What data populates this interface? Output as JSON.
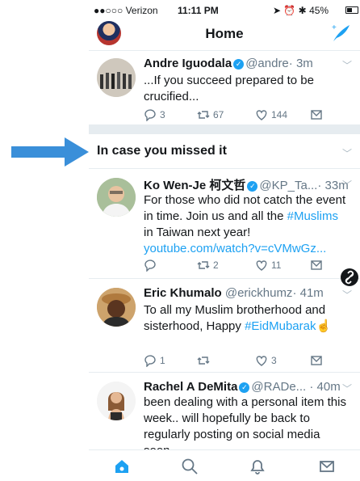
{
  "status": {
    "carrier": "●●○○○ Verizon",
    "time": "11:11 PM",
    "battery": "45%"
  },
  "header": {
    "title": "Home"
  },
  "tweets": [
    {
      "name": "Andre Iguodala",
      "handle": "@andre",
      "time": "· 3m",
      "text": "...If you succeed prepared to be crucified...",
      "replies": "3",
      "retweets": "67",
      "likes": "144"
    },
    {
      "name": "Ko Wen-Je 柯文哲",
      "handle": "@KP_Ta...",
      "time": "· 33m",
      "text_pre": "For those who did not catch the event in time. Join us and all the ",
      "hashtag": "#Muslims",
      "text_mid": " in Taiwan next year! ",
      "link": "youtube.com/watch?v=cVMwGz...",
      "replies": "",
      "retweets": "2",
      "likes": "11"
    },
    {
      "name": "Eric Khumalo",
      "handle": "@erickhumz",
      "time": "· 41m",
      "text_pre": "To all my Muslim brotherhood and sisterhood, Happy ",
      "hashtag": "#EidMubarak",
      "emoji": "☝",
      "replies": "1",
      "retweets": "",
      "likes": "3"
    },
    {
      "name": "Rachel A DeMita",
      "handle": "@RADe...",
      "time": "· 40m",
      "text": "been dealing with a personal item this week.. will hopefully be back to regularly posting on social media soon."
    }
  ],
  "section": {
    "title": "In case you missed it"
  },
  "colors": {
    "accent": "#1da1f2",
    "arrow": "#3a8fd9"
  },
  "icons": [
    "home-icon",
    "search-icon",
    "notifications-icon",
    "messages-icon",
    "compose-icon"
  ]
}
